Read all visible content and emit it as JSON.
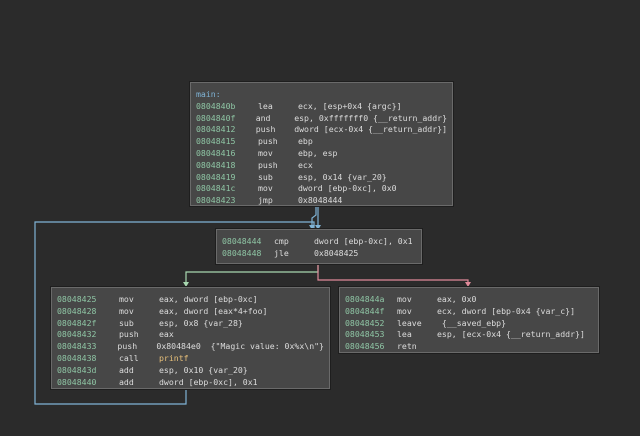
{
  "blocks": {
    "main": {
      "label": "main:",
      "rows": [
        {
          "addr": "0804840b",
          "mn": "lea",
          "op": "ecx, [esp+0x4 {argc}]"
        },
        {
          "addr": "0804840f",
          "mn": "and",
          "op": "esp, 0xfffffff0 {__return_addr}"
        },
        {
          "addr": "08048412",
          "mn": "push",
          "op": "dword [ecx-0x4 {__return_addr}]"
        },
        {
          "addr": "08048415",
          "mn": "push",
          "op": "ebp"
        },
        {
          "addr": "08048416",
          "mn": "mov",
          "op": "ebp, esp"
        },
        {
          "addr": "08048418",
          "mn": "push",
          "op": "ecx"
        },
        {
          "addr": "08048419",
          "mn": "sub",
          "op": "esp, 0x14 {var_20}"
        },
        {
          "addr": "0804841c",
          "mn": "mov",
          "op": "dword [ebp-0xc], 0x0"
        },
        {
          "addr": "08048423",
          "mn": "jmp",
          "op": "0x8048444"
        }
      ]
    },
    "cmp": {
      "rows": [
        {
          "addr": "08048444",
          "mn": "cmp",
          "op": "dword [ebp-0xc], 0x1"
        },
        {
          "addr": "08048448",
          "mn": "jle",
          "op": "0x8048425"
        }
      ]
    },
    "loop": {
      "rows": [
        {
          "addr": "08048425",
          "mn": "mov",
          "op": "eax, dword [ebp-0xc]"
        },
        {
          "addr": "08048428",
          "mn": "mov",
          "op": "eax, dword [eax*4+foo]"
        },
        {
          "addr": "0804842f",
          "mn": "sub",
          "op": "esp, 0x8 {var_28}"
        },
        {
          "addr": "08048432",
          "mn": "push",
          "op": "eax"
        },
        {
          "addr": "08048433",
          "mn": "push",
          "op": "0x80484e0  {\"Magic value: 0x%x\\n\"}"
        },
        {
          "addr": "08048438",
          "mn": "call",
          "op": "printf"
        },
        {
          "addr": "0804843d",
          "mn": "add",
          "op": "esp, 0x10 {var_20}"
        },
        {
          "addr": "08048440",
          "mn": "add",
          "op": "dword [ebp-0xc], 0x1"
        }
      ]
    },
    "exit": {
      "rows": [
        {
          "addr": "0804844a",
          "mn": "mov",
          "op": "eax, 0x0"
        },
        {
          "addr": "0804844f",
          "mn": "mov",
          "op": "ecx, dword [ebp-0x4 {var_c}]"
        },
        {
          "addr": "08048452",
          "mn": "leave",
          "op": " {__saved_ebp}"
        },
        {
          "addr": "08048453",
          "mn": "lea",
          "op": "esp, [ecx-0x4 {__return_addr}]"
        },
        {
          "addr": "08048456",
          "mn": "retn",
          "op": ""
        }
      ]
    }
  },
  "colors": {
    "edge_unconditional": "#7fb3d5",
    "edge_true": "#a8d8b0",
    "edge_false": "#e08a9a"
  }
}
